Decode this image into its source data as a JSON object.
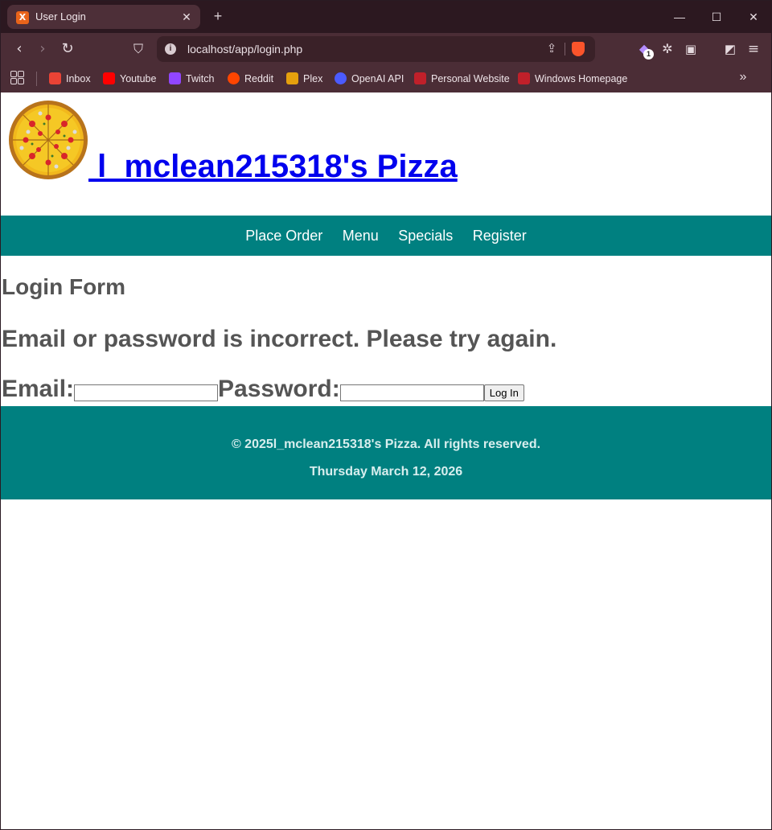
{
  "browser": {
    "tab_title": "User Login",
    "tab_favicon": "xampp-icon",
    "url": "localhost/app/login.php",
    "extension_badge": "1",
    "bookmarks": [
      {
        "label": "Inbox",
        "icon": "gmail-icon",
        "color": "#ea4335"
      },
      {
        "label": "Youtube",
        "icon": "youtube-icon",
        "color": "#ff0000"
      },
      {
        "label": "Twitch",
        "icon": "twitch-icon",
        "color": "#9146ff"
      },
      {
        "label": "Reddit",
        "icon": "reddit-icon",
        "color": "#ff4500"
      },
      {
        "label": "Plex",
        "icon": "plex-icon",
        "color": "#e5a00d"
      },
      {
        "label": "OpenAI API",
        "icon": "openai-icon",
        "color": "#4b5bff"
      },
      {
        "label": "Personal Website",
        "icon": "website-icon",
        "color": "#c0202a"
      },
      {
        "label": "Windows Homepage",
        "icon": "website-icon",
        "color": "#c0202a"
      }
    ]
  },
  "site": {
    "title": " l_mclean215318's Pizza",
    "nav": [
      "Place Order",
      "Menu",
      "Specials",
      "Register"
    ],
    "accent": "#008080"
  },
  "login": {
    "heading": "Login Form",
    "error": "Email or password is incorrect. Please try again.",
    "email_label": "Email:",
    "email_value": "",
    "password_label": "Password:",
    "password_value": "",
    "submit_label": "Log In"
  },
  "footer": {
    "copyright": "© 2025l_mclean215318's Pizza. All rights reserved.",
    "date": "Thursday March 12, 2026"
  }
}
